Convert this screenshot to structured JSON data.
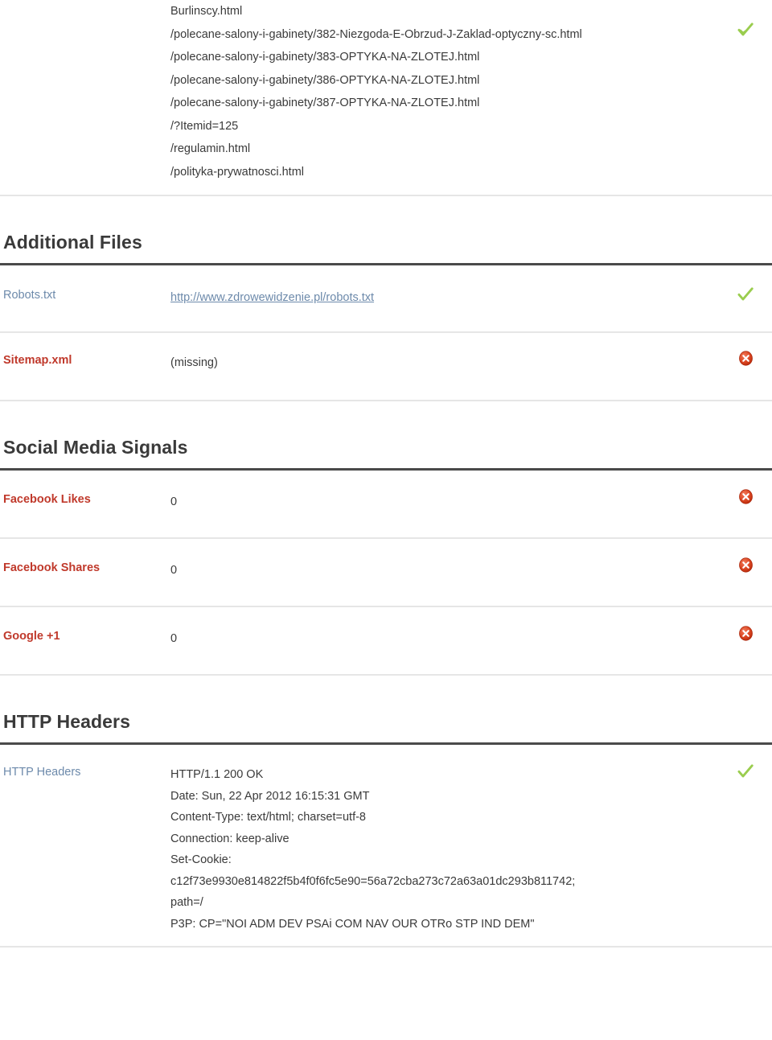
{
  "url_list_row": {
    "status": "ok",
    "urls": [
      "Burlinscy.html",
      "/polecane-salony-i-gabinety/382-Niezgoda-E-Obrzud-J-Zaklad-optyczny-sc.html",
      "/polecane-salony-i-gabinety/383-OPTYKA-NA-ZLOTEJ.html",
      "/polecane-salony-i-gabinety/386-OPTYKA-NA-ZLOTEJ.html",
      "/polecane-salony-i-gabinety/387-OPTYKA-NA-ZLOTEJ.html",
      "/?Itemid=125",
      "/regulamin.html",
      "/polityka-prywatnosci.html"
    ]
  },
  "sections": {
    "additional_files": {
      "title": "Additional Files",
      "rows": {
        "robots": {
          "label": "Robots.txt",
          "value": "http://www.zdrowewidzenie.pl/robots.txt",
          "status": "ok"
        },
        "sitemap": {
          "label": "Sitemap.xml",
          "value": "(missing)",
          "status": "bad"
        }
      }
    },
    "social_media": {
      "title": "Social Media Signals",
      "rows": {
        "facebook_likes": {
          "label": "Facebook Likes",
          "value": "0",
          "status": "bad"
        },
        "facebook_shares": {
          "label": "Facebook Shares",
          "value": "0",
          "status": "bad"
        },
        "google_plus_one": {
          "label": "Google +1",
          "value": "0",
          "status": "bad"
        }
      }
    },
    "http_headers": {
      "title": "HTTP Headers",
      "row": {
        "label": "HTTP Headers",
        "status": "ok",
        "lines": [
          "HTTP/1.1 200 OK",
          "Date: Sun, 22 Apr 2012 16:15:31 GMT",
          "Content-Type: text/html; charset=utf-8",
          "Connection: keep-alive",
          "Set-Cookie:",
          "c12f73e9930e814822f5b4f0f6fc5e90=56a72cba273c72a63a01dc293b811742;",
          "path=/",
          "P3P: CP=\"NOI ADM DEV PSAi COM NAV OUR OTRo STP IND DEM\""
        ]
      }
    }
  },
  "icons": {
    "ok": "check-icon",
    "bad": "error-icon"
  },
  "colors": {
    "ok_green": "#9ACD4E",
    "bad_red": "#D23A1E",
    "label_muted": "#6D8AAB",
    "label_bad": "#C0392B",
    "heading": "#3A3A3A",
    "divider": "#E6E6E6",
    "rule": "#4A4A4A"
  }
}
